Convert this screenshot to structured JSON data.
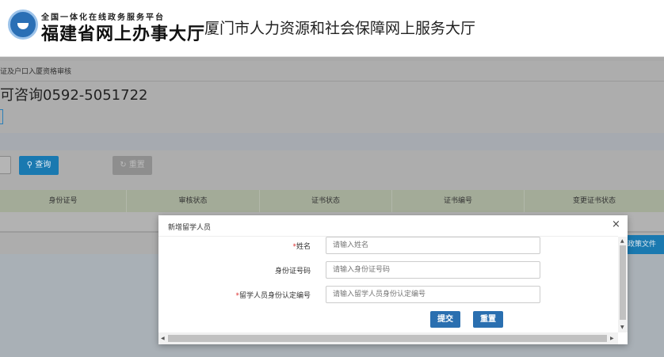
{
  "header": {
    "platform_sub": "全国一体化在线政务服务平台",
    "platform_name": "福建省网上办事大厅",
    "site_title": "厦门市人力资源和社会保障网上服务大厅"
  },
  "page": {
    "breadcrumb": "证及户口入厦资格审核",
    "phone": "可咨询0592-5051722",
    "search_label": "查询",
    "reset_label": "重置",
    "policy_button": "政策文件"
  },
  "table": {
    "columns": [
      "身份证号",
      "审核状态",
      "证书状态",
      "证书编号",
      "变更证书状态"
    ]
  },
  "modal": {
    "title": "新增留学人员",
    "close": "×",
    "fields": [
      {
        "label": "姓名",
        "required": true,
        "placeholder": "请输入姓名"
      },
      {
        "label": "身份证号码",
        "required": false,
        "placeholder": "请输入身份证号码"
      },
      {
        "label": "留学人员身份认定编号",
        "required": true,
        "placeholder": "请输入留学人员身份认定编号"
      }
    ],
    "submit": "提交",
    "reset": "重置"
  },
  "colors": {
    "primary": "#2a6fb0",
    "overlay": "#adadad"
  }
}
